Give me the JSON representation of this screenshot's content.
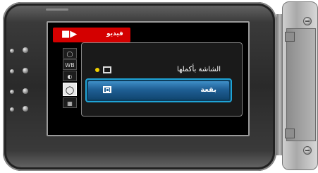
{
  "header": {
    "tab_label": "فيديو",
    "tab_icon": "camera-icon"
  },
  "sidebar": {
    "items": [
      {
        "name": "stabilizer-icon",
        "text": ""
      },
      {
        "name": "white-balance-icon",
        "text": "WB"
      },
      {
        "name": "backlight-icon",
        "text": ""
      },
      {
        "name": "metering-area-icon",
        "text": ""
      },
      {
        "name": "scene-icon",
        "text": ""
      }
    ]
  },
  "menu": {
    "options": [
      {
        "label": "الشاشة بأكملها",
        "icon": "full-screen-icon",
        "selected_marker": true
      },
      {
        "label": "بقعة",
        "icon": "spot-icon",
        "highlighted": true
      }
    ]
  },
  "colors": {
    "accent_red": "#d40000",
    "highlight_blue": "#1fa3d6",
    "marker_yellow": "#f0d000"
  }
}
